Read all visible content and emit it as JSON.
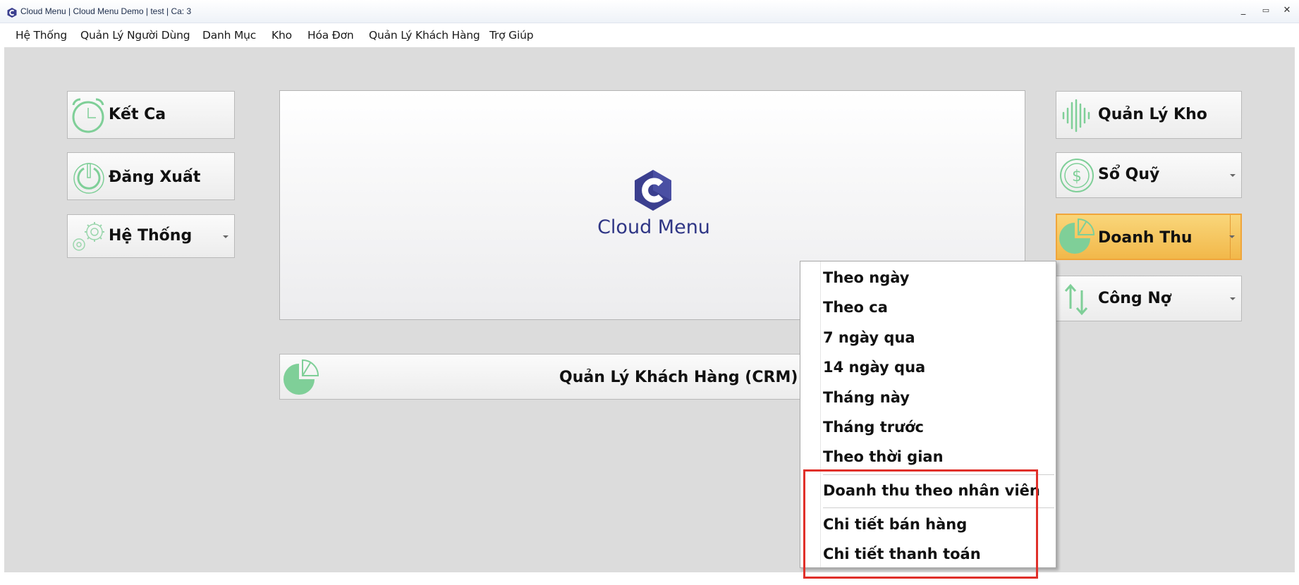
{
  "window": {
    "title": "Cloud Menu | Cloud Menu Demo | test | Ca: 3",
    "controls": [
      "_",
      "▭",
      "✕"
    ]
  },
  "menubar": {
    "items": [
      "Hệ Thống",
      "Quản Lý Người Dùng",
      "Danh Mục",
      "Kho",
      "Hóa Đơn",
      "Quản Lý Khách Hàng",
      "Trợ Giúp"
    ]
  },
  "left_tiles": {
    "ket_ca": "Kết Ca",
    "dang_xuat": "Đăng Xuất",
    "he_thong": "Hệ Thống"
  },
  "center": {
    "logo_text": "Cloud Menu",
    "crm_label": "Quản Lý Khách Hàng (CRM)"
  },
  "right_tiles": {
    "quan_ly_kho": "Quản Lý Kho",
    "so_quy": "Sổ Quỹ",
    "doanh_thu": "Doanh Thu",
    "cong_no": "Công Nợ"
  },
  "dropdown": {
    "items": [
      "Theo ngày",
      "Theo ca",
      "7 ngày qua",
      "14 ngày qua",
      "Tháng này",
      "Tháng trước",
      "Theo thời gian",
      "Doanh thu theo nhân viên",
      "Chi tiết bán hàng",
      "Chi tiết thanh toán"
    ]
  },
  "colors": {
    "accent_green": "#7fcf98",
    "active_orange": "#f2b84a",
    "logo_blue": "#2f3685",
    "highlight_red": "#e0302a"
  }
}
